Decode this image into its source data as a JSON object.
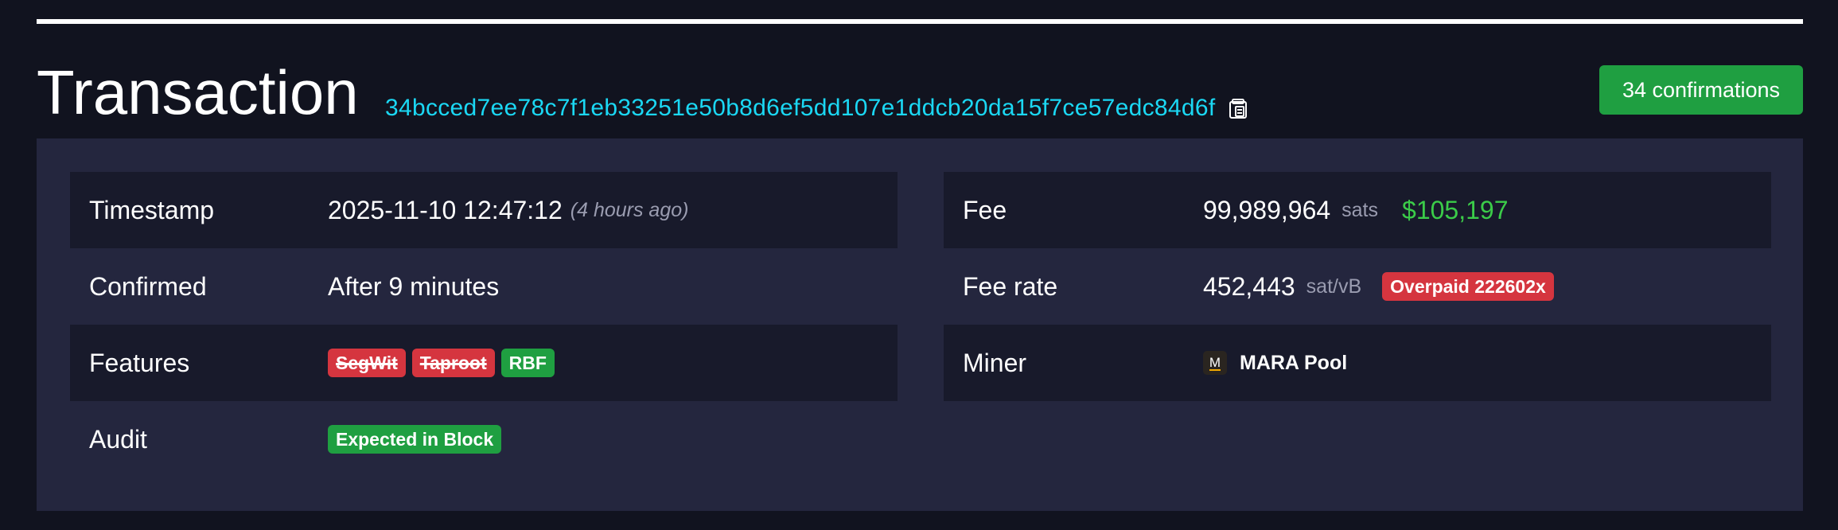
{
  "header": {
    "title": "Transaction",
    "txid": "34bcced7ee78c7f1eb33251e50b8d6ef5dd107e1ddcb20da15f7ce57edc84d6f",
    "confirmations": "34 confirmations"
  },
  "left": {
    "timestamp": {
      "label": "Timestamp",
      "value": "2025-11-10 12:47:12",
      "relative": "(4 hours ago)"
    },
    "confirmed": {
      "label": "Confirmed",
      "value": "After 9 minutes"
    },
    "features": {
      "label": "Features",
      "badges": [
        "SegWit",
        "Taproot",
        "RBF"
      ]
    },
    "audit": {
      "label": "Audit",
      "badge": "Expected in Block"
    }
  },
  "right": {
    "fee": {
      "label": "Fee",
      "value": "99,989,964",
      "unit": "sats",
      "fiat": "$105,197"
    },
    "fee_rate": {
      "label": "Fee rate",
      "value": "452,443",
      "unit": "sat/vB",
      "badge": "Overpaid 222602x"
    },
    "miner": {
      "label": "Miner",
      "logo_letter": "M",
      "name": "MARA Pool"
    }
  },
  "colors": {
    "background": "#11131f",
    "panel": "#24263e",
    "row_dark": "#181a2b",
    "txid": "#1bd8f4",
    "green": "#1f9f41",
    "red": "#d5353f",
    "fiat": "#3bcc49"
  },
  "icons": {
    "copy": "clipboard-copy-icon",
    "pool_logo": "mara-pool-logo"
  }
}
